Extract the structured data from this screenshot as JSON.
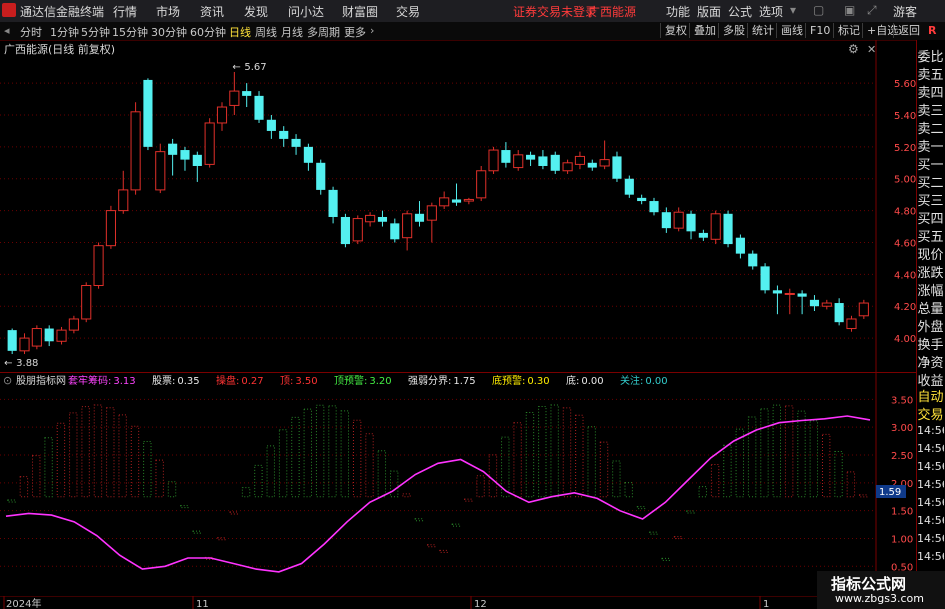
{
  "topbar": {
    "app_title": "通达信金融终端",
    "menu": [
      "行情",
      "市场",
      "资讯",
      "发现",
      "问小达",
      "财富圈",
      "交易"
    ],
    "notice": "证券交易未登录",
    "stock_name": "广西能源",
    "right_menu": [
      "功能",
      "版面",
      "公式",
      "选项"
    ],
    "guest": "游客"
  },
  "periods": [
    "分时",
    "1分钟",
    "5分钟",
    "15分钟",
    "30分钟",
    "60分钟",
    "日线",
    "周线",
    "月线",
    "多周期",
    "更多"
  ],
  "active_period": "日线",
  "toolbar_right": [
    "复权",
    "叠加",
    "多股",
    "统计",
    "画线",
    "F10",
    "标记",
    "+自选",
    "返回"
  ],
  "r_badge": "R",
  "main_chart": {
    "title": "广西能源(日线 前复权)",
    "high_label": "5.67",
    "low_label": "3.88",
    "y_ticks": [
      "5.60",
      "5.40",
      "5.20",
      "5.00",
      "4.80",
      "4.60",
      "4.40",
      "4.20",
      "4.00"
    ],
    "colors": {
      "up": "#e0302a",
      "down": "#54f0f0",
      "grid": "#6a0000"
    }
  },
  "sub_chart": {
    "name": "股朋指标网",
    "items": [
      {
        "label": "套牢筹码:",
        "value": "3.13",
        "color": "#ff44ff"
      },
      {
        "label": "股票:",
        "value": "0.35",
        "color": "#e8e8e8"
      },
      {
        "label": "操盘:",
        "value": "0.27",
        "color": "#ff3333"
      },
      {
        "label": "顶:",
        "value": "3.50",
        "color": "#ff3333"
      },
      {
        "label": "顶预警:",
        "value": "3.20",
        "color": "#44ee44"
      },
      {
        "label": "强弱分界:",
        "value": "1.75",
        "color": "#e8e8e8"
      },
      {
        "label": "底预警:",
        "value": "0.30",
        "color": "#ffee00"
      },
      {
        "label": "底:",
        "value": "0.00",
        "color": "#e8e8e8"
      },
      {
        "label": "关注:",
        "value": "0.00",
        "color": "#33cccc"
      }
    ],
    "y_ticks": [
      "3.50",
      "3.00",
      "2.50",
      "2.00",
      "1.50",
      "1.00",
      "0.50"
    ],
    "current_value": "1.59"
  },
  "x_axis": {
    "labels": [
      "2024年",
      "11",
      "12",
      "1"
    ]
  },
  "right_panel": {
    "items": [
      "委比",
      "卖五",
      "卖四",
      "卖三",
      "卖二",
      "卖一",
      "买一",
      "买二",
      "买三",
      "买四",
      "买五",
      "现价",
      "涨跌",
      "涨幅",
      "总量",
      "外盘",
      "换手",
      "净资",
      "收益"
    ],
    "lower": [
      "自动",
      "交易"
    ],
    "times": [
      "14:56",
      "14:56",
      "14:56",
      "14:56",
      "14:56",
      "14:56",
      "14:56",
      "14:56"
    ]
  },
  "watermark": {
    "title": "指标公式网",
    "url": "www.zbgs3.com"
  },
  "chart_data": {
    "type": "candlestick",
    "title": "广西能源(日线 前复权)",
    "ylim": [
      3.85,
      5.72
    ],
    "candles": [
      [
        4.05,
        3.92,
        4.06,
        3.9
      ],
      [
        3.92,
        4.0,
        4.03,
        3.9
      ],
      [
        3.95,
        4.06,
        4.08,
        3.93
      ],
      [
        4.06,
        3.98,
        4.08,
        3.95
      ],
      [
        3.98,
        4.05,
        4.07,
        3.96
      ],
      [
        4.05,
        4.12,
        4.14,
        4.03
      ],
      [
        4.12,
        4.33,
        4.35,
        4.1
      ],
      [
        4.33,
        4.58,
        4.6,
        4.31
      ],
      [
        4.58,
        4.8,
        4.83,
        4.56
      ],
      [
        4.8,
        4.93,
        5.05,
        4.78
      ],
      [
        4.93,
        5.42,
        5.48,
        4.9
      ],
      [
        5.62,
        5.2,
        5.63,
        5.18
      ],
      [
        4.93,
        5.17,
        5.22,
        4.91
      ],
      [
        5.22,
        5.15,
        5.25,
        5.02
      ],
      [
        5.18,
        5.12,
        5.2,
        5.05
      ],
      [
        5.15,
        5.08,
        5.17,
        4.98
      ],
      [
        5.09,
        5.35,
        5.38,
        5.07
      ],
      [
        5.35,
        5.45,
        5.48,
        5.3
      ],
      [
        5.46,
        5.55,
        5.67,
        5.4
      ],
      [
        5.55,
        5.52,
        5.6,
        5.45
      ],
      [
        5.52,
        5.37,
        5.55,
        5.35
      ],
      [
        5.37,
        5.3,
        5.4,
        5.25
      ],
      [
        5.3,
        5.25,
        5.33,
        5.2
      ],
      [
        5.25,
        5.2,
        5.28,
        5.15
      ],
      [
        5.2,
        5.1,
        5.22,
        5.05
      ],
      [
        5.1,
        4.93,
        5.12,
        4.9
      ],
      [
        4.93,
        4.76,
        4.95,
        4.72
      ],
      [
        4.76,
        4.59,
        4.78,
        4.57
      ],
      [
        4.61,
        4.75,
        4.77,
        4.59
      ],
      [
        4.73,
        4.77,
        4.79,
        4.7
      ],
      [
        4.76,
        4.73,
        4.8,
        4.7
      ],
      [
        4.72,
        4.62,
        4.75,
        4.6
      ],
      [
        4.63,
        4.78,
        4.8,
        4.55
      ],
      [
        4.78,
        4.73,
        4.86,
        4.7
      ],
      [
        4.74,
        4.83,
        4.85,
        4.6
      ],
      [
        4.83,
        4.88,
        4.92,
        4.81
      ],
      [
        4.87,
        4.85,
        4.97,
        4.83
      ],
      [
        4.86,
        4.87,
        4.88,
        4.84
      ],
      [
        4.88,
        5.05,
        5.08,
        4.86
      ],
      [
        5.05,
        5.18,
        5.2,
        5.03
      ],
      [
        5.18,
        5.1,
        5.23,
        5.07
      ],
      [
        5.07,
        5.15,
        5.18,
        5.05
      ],
      [
        5.15,
        5.12,
        5.17,
        5.08
      ],
      [
        5.14,
        5.08,
        5.18,
        5.06
      ],
      [
        5.15,
        5.05,
        5.17,
        5.03
      ],
      [
        5.05,
        5.1,
        5.12,
        5.03
      ],
      [
        5.09,
        5.14,
        5.17,
        5.06
      ],
      [
        5.1,
        5.07,
        5.12,
        5.05
      ],
      [
        5.08,
        5.12,
        5.24,
        5.06
      ],
      [
        5.14,
        5.0,
        5.17,
        4.98
      ],
      [
        5.0,
        4.9,
        5.02,
        4.88
      ],
      [
        4.88,
        4.86,
        4.9,
        4.84
      ],
      [
        4.86,
        4.79,
        4.88,
        4.77
      ],
      [
        4.79,
        4.69,
        4.82,
        4.66
      ],
      [
        4.69,
        4.79,
        4.82,
        4.67
      ],
      [
        4.78,
        4.67,
        4.8,
        4.62
      ],
      [
        4.66,
        4.63,
        4.68,
        4.61
      ],
      [
        4.62,
        4.78,
        4.8,
        4.59
      ],
      [
        4.78,
        4.59,
        4.8,
        4.57
      ],
      [
        4.63,
        4.53,
        4.65,
        4.5
      ],
      [
        4.53,
        4.45,
        4.55,
        4.43
      ],
      [
        4.45,
        4.3,
        4.47,
        4.28
      ],
      [
        4.3,
        4.28,
        4.33,
        4.15
      ],
      [
        4.28,
        4.28,
        4.31,
        4.15
      ],
      [
        4.28,
        4.26,
        4.3,
        4.15
      ],
      [
        4.24,
        4.2,
        4.27,
        4.17
      ],
      [
        4.2,
        4.22,
        4.24,
        4.18
      ],
      [
        4.22,
        4.1,
        4.25,
        4.08
      ],
      [
        4.06,
        4.12,
        4.14,
        4.04
      ],
      [
        4.14,
        4.22,
        4.24,
        4.12
      ]
    ],
    "sub_line": [
      1.4,
      1.45,
      1.42,
      1.3,
      1.05,
      0.7,
      0.45,
      0.5,
      0.65,
      0.65,
      0.55,
      0.45,
      0.4,
      0.55,
      0.9,
      1.3,
      1.65,
      1.85,
      2.15,
      2.35,
      2.42,
      2.2,
      1.85,
      1.65,
      1.75,
      1.82,
      1.72,
      1.5,
      1.35,
      1.65,
      2.05,
      2.45,
      2.75,
      2.95,
      3.08,
      3.12,
      3.15,
      3.2,
      3.13
    ]
  }
}
